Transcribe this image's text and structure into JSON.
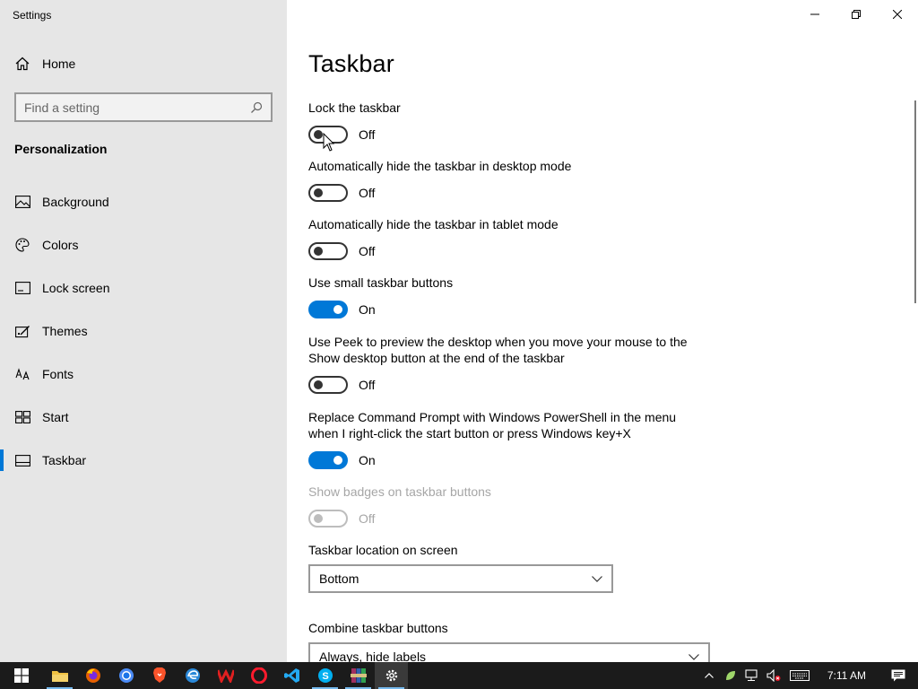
{
  "window": {
    "title": "Settings"
  },
  "sidebar": {
    "home_label": "Home",
    "search_placeholder": "Find a setting",
    "section": "Personalization",
    "items": [
      {
        "label": "Background",
        "icon": "picture-icon"
      },
      {
        "label": "Colors",
        "icon": "palette-icon"
      },
      {
        "label": "Lock screen",
        "icon": "lock-screen-icon"
      },
      {
        "label": "Themes",
        "icon": "themes-icon"
      },
      {
        "label": "Fonts",
        "icon": "fonts-icon"
      },
      {
        "label": "Start",
        "icon": "start-icon"
      },
      {
        "label": "Taskbar",
        "icon": "taskbar-icon",
        "active": true
      }
    ]
  },
  "main": {
    "title": "Taskbar",
    "settings": [
      {
        "label": "Lock the taskbar",
        "state": "Off"
      },
      {
        "label": "Automatically hide the taskbar in desktop mode",
        "state": "Off"
      },
      {
        "label": "Automatically hide the taskbar in tablet mode",
        "state": "Off"
      },
      {
        "label": "Use small taskbar buttons",
        "state": "On"
      },
      {
        "label_line1": "Use Peek to preview the desktop when you move your mouse to the",
        "label_line2": "Show desktop button at the end of the taskbar",
        "state": "Off"
      },
      {
        "label_line1": "Replace Command Prompt with Windows PowerShell in the menu",
        "label_line2": "when I right-click the start button or press Windows key+X",
        "state": "On"
      },
      {
        "label": "Show badges on taskbar buttons",
        "state": "Off",
        "disabled": true
      }
    ],
    "location_label": "Taskbar location on screen",
    "location_value": "Bottom",
    "combine_label": "Combine taskbar buttons",
    "combine_value": "Always, hide labels"
  },
  "taskbar": {
    "apps": [
      "file-explorer-icon",
      "firefox-icon",
      "chrome-icon",
      "brave-icon",
      "edge-icon",
      "wps-icon",
      "opera-icon",
      "vscode-icon",
      "skype-icon",
      "winrar-icon",
      "settings-icon"
    ],
    "clock": "7:11 AM"
  },
  "colors": {
    "accent": "#0078d7",
    "sidebar_bg": "#e6e6e6",
    "taskbar_bg": "#1b1b1b"
  }
}
